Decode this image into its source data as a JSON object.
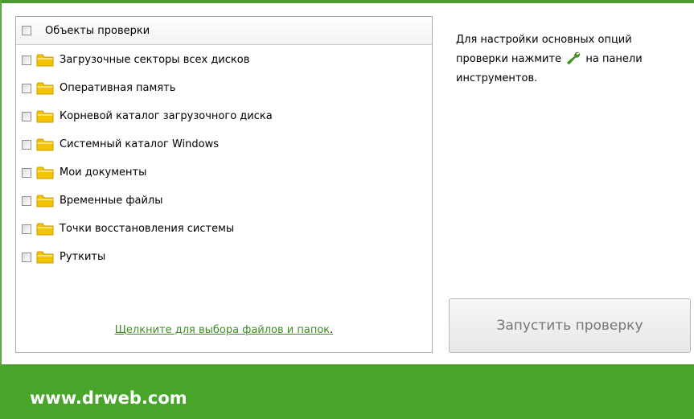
{
  "objects": {
    "header_label": "Объекты проверки",
    "items": [
      {
        "label": "Загрузочные секторы всех дисков",
        "checked": false
      },
      {
        "label": "Оперативная память",
        "checked": false
      },
      {
        "label": "Корневой каталог загрузочного диска",
        "checked": false
      },
      {
        "label": "Системный каталог Windows",
        "checked": false
      },
      {
        "label": "Мои документы",
        "checked": false
      },
      {
        "label": "Временные файлы",
        "checked": false
      },
      {
        "label": "Точки восстановления системы",
        "checked": false
      },
      {
        "label": "Руткиты",
        "checked": false
      }
    ],
    "select_link": "Щелкните для выбора файлов и папок",
    "select_link_suffix": "."
  },
  "hint": {
    "before_icon": "Для настройки основных опций проверки нажмите",
    "icon": "wrench-icon",
    "after_icon": "на панели инструментов."
  },
  "scan_button_label": "Запустить проверку",
  "footer": {
    "url": "www.drweb.com"
  },
  "colors": {
    "brand_green": "#48a52a",
    "link_green": "#3e8e1e",
    "folder_yellow": "#f5c400"
  }
}
